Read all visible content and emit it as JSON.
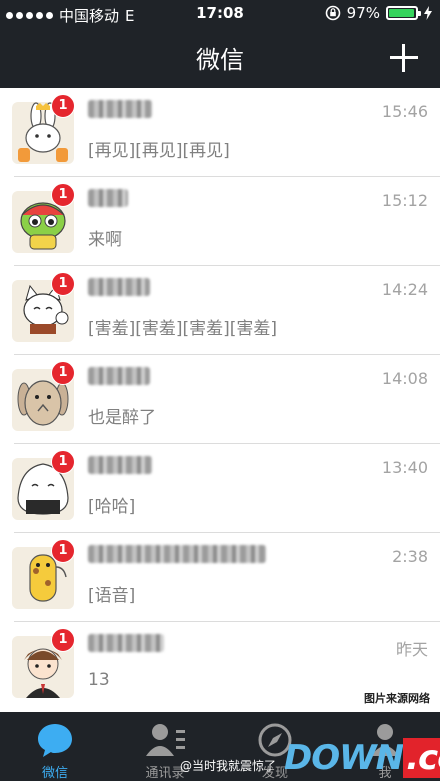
{
  "status_bar": {
    "carrier": "中国移动",
    "network": "E",
    "time": "17:08",
    "battery": "97%",
    "battery_level": 0.97
  },
  "nav": {
    "title": "微信",
    "add_icon": "plus-icon"
  },
  "chats": [
    {
      "time": "15:46",
      "message": "[再见][再见][再见]",
      "badge": "1",
      "avatar": "rabbit-sticker"
    },
    {
      "time": "15:12",
      "message": "来啊",
      "badge": "1",
      "avatar": "frog-helmet-sticker"
    },
    {
      "time": "14:24",
      "message": "[害羞][害羞][害羞][害羞]",
      "badge": "1",
      "avatar": "lucky-cat-sticker"
    },
    {
      "time": "14:08",
      "message": "也是醉了",
      "badge": "1",
      "avatar": "bunny-sticker"
    },
    {
      "time": "13:40",
      "message": "[哈哈]",
      "badge": "1",
      "avatar": "rice-ball-sticker"
    },
    {
      "time": "2:38",
      "message": "[语音]",
      "badge": "1",
      "avatar": "giraffe-sticker"
    },
    {
      "time": "昨天",
      "message": "13",
      "badge": "1",
      "avatar": "cartoon-boy-avatar"
    }
  ],
  "tabs": [
    {
      "label": "微信",
      "icon": "chat-bubble-icon",
      "active": true
    },
    {
      "label": "通讯录",
      "icon": "contacts-icon",
      "active": false
    },
    {
      "label": "发现",
      "icon": "compass-icon",
      "active": false
    },
    {
      "label": "我",
      "icon": "person-icon",
      "active": false
    }
  ],
  "watermark": "图片来源网络",
  "weibo_credit": "@当时我就震惊了",
  "logo": {
    "down": "DOWN",
    "cc": ".cc"
  },
  "colors": {
    "bar": "#1f2328",
    "accent": "#3dadf2",
    "badge": "#e5262e",
    "battery": "#35d35c"
  }
}
